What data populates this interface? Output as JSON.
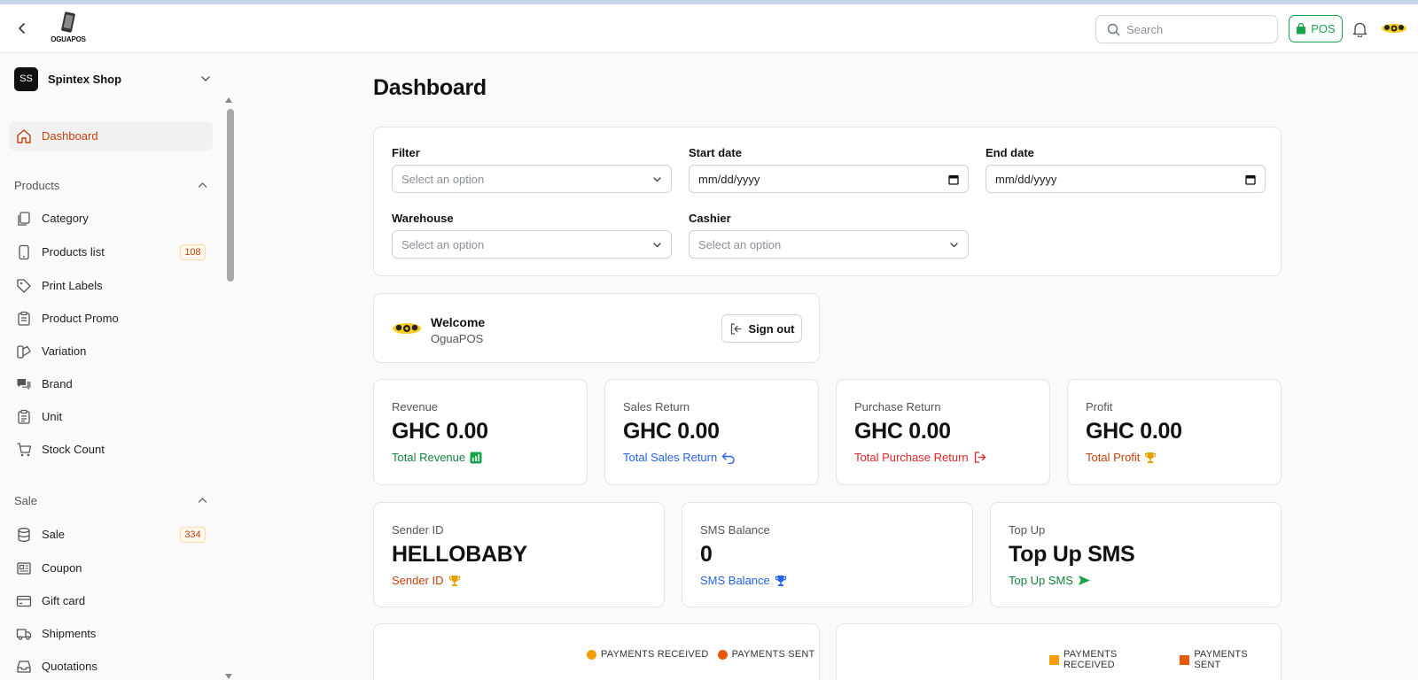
{
  "header": {
    "logo_text": "OGUAPOS",
    "search_placeholder": "Search",
    "pos_label": "POS"
  },
  "sidebar": {
    "shop_initials": "SS",
    "shop_name": "Spintex Shop",
    "dashboard": "Dashboard",
    "products_section": "Products",
    "products_items": [
      {
        "label": "Category"
      },
      {
        "label": "Products list",
        "badge": "108"
      },
      {
        "label": "Print Labels"
      },
      {
        "label": "Product Promo"
      },
      {
        "label": "Variation"
      },
      {
        "label": "Brand"
      },
      {
        "label": "Unit"
      },
      {
        "label": "Stock Count"
      }
    ],
    "sale_section": "Sale",
    "sale_items": [
      {
        "label": "Sale",
        "badge": "334"
      },
      {
        "label": "Coupon"
      },
      {
        "label": "Gift card"
      },
      {
        "label": "Shipments"
      },
      {
        "label": "Quotations"
      }
    ]
  },
  "page": {
    "title": "Dashboard"
  },
  "filters": {
    "filter_label": "Filter",
    "filter_placeholder": "Select an option",
    "start_label": "Start date",
    "start_value": "mm/dd/yyyy",
    "end_label": "End date",
    "end_value": "mm/dd/yyyy",
    "warehouse_label": "Warehouse",
    "warehouse_placeholder": "Select an option",
    "cashier_label": "Cashier",
    "cashier_placeholder": "Select an option"
  },
  "welcome": {
    "title": "Welcome",
    "subtitle": "OguaPOS",
    "signout_label": "Sign out"
  },
  "stats": [
    {
      "label": "Revenue",
      "value": "GHC 0.00",
      "foot": "Total Revenue",
      "color": "#15803d"
    },
    {
      "label": "Sales Return",
      "value": "GHC 0.00",
      "foot": "Total Sales Return",
      "color": "#2563eb"
    },
    {
      "label": "Purchase Return",
      "value": "GHC 0.00",
      "foot": "Total Purchase Return",
      "color": "#dc2626"
    },
    {
      "label": "Profit",
      "value": "GHC 0.00",
      "foot": "Total Profit",
      "color": "#c2410c"
    }
  ],
  "sms": [
    {
      "label": "Sender ID",
      "value": "HELLOBABY",
      "foot": "Sender ID",
      "color": "#c2410c"
    },
    {
      "label": "SMS Balance",
      "value": "0",
      "foot": "SMS Balance",
      "color": "#2563eb"
    },
    {
      "label": "Top Up",
      "value": "Top Up SMS",
      "foot": "Top Up SMS",
      "color": "#15803d"
    }
  ],
  "charts": {
    "left_legend": [
      "PAYMENTS RECEIVED",
      "PAYMENTS SENT"
    ],
    "right_legend": [
      "PAYMENTS RECEIVED",
      "PAYMENTS SENT"
    ],
    "received_color": "#f59e0b",
    "sent_color": "#ea580c"
  }
}
